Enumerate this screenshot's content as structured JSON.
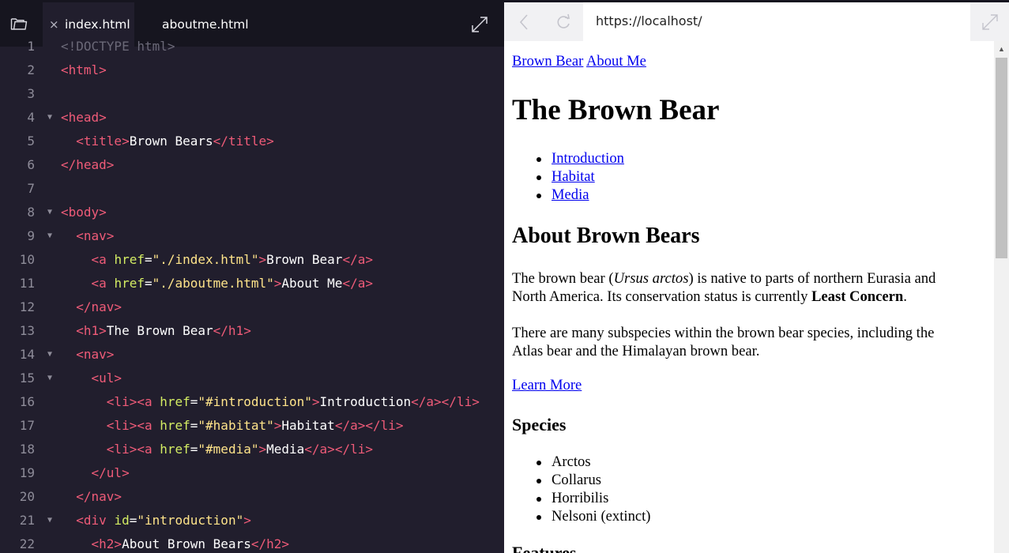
{
  "editor": {
    "tabs": [
      {
        "label": "index.html",
        "active": true,
        "close_glyph": "×"
      },
      {
        "label": "aboutme.html",
        "active": false
      }
    ],
    "lines": [
      {
        "n": "1",
        "fold": false,
        "html": "<span class='faded'>&lt;!DOCTYPE html&gt;</span>"
      },
      {
        "n": "2",
        "fold": false,
        "html": "<span class='t'>&lt;html&gt;</span>"
      },
      {
        "n": "3",
        "fold": false,
        "html": ""
      },
      {
        "n": "4",
        "fold": true,
        "html": "<span class='t'>&lt;head&gt;</span>"
      },
      {
        "n": "5",
        "fold": false,
        "html": "  <span class='t'>&lt;title&gt;</span>Brown Bears<span class='t'>&lt;/title&gt;</span>"
      },
      {
        "n": "6",
        "fold": false,
        "html": "<span class='t'>&lt;/head&gt;</span>"
      },
      {
        "n": "7",
        "fold": false,
        "html": ""
      },
      {
        "n": "8",
        "fold": true,
        "html": "<span class='t'>&lt;body&gt;</span>"
      },
      {
        "n": "9",
        "fold": true,
        "html": "  <span class='t'>&lt;nav&gt;</span>"
      },
      {
        "n": "10",
        "fold": false,
        "html": "    <span class='t'>&lt;a</span> <span class='an'>href</span><span class='eq'>=</span><span class='av'>\"./index.html\"</span><span class='t'>&gt;</span>Brown Bear<span class='t'>&lt;/a&gt;</span>"
      },
      {
        "n": "11",
        "fold": false,
        "html": "    <span class='t'>&lt;a</span> <span class='an'>href</span><span class='eq'>=</span><span class='av'>\"./aboutme.html\"</span><span class='t'>&gt;</span>About Me<span class='t'>&lt;/a&gt;</span>"
      },
      {
        "n": "12",
        "fold": false,
        "html": "  <span class='t'>&lt;/nav&gt;</span>"
      },
      {
        "n": "13",
        "fold": false,
        "html": "  <span class='t'>&lt;h1&gt;</span>The Brown Bear<span class='t'>&lt;/h1&gt;</span>"
      },
      {
        "n": "14",
        "fold": true,
        "html": "  <span class='t'>&lt;nav&gt;</span>"
      },
      {
        "n": "15",
        "fold": true,
        "html": "    <span class='t'>&lt;ul&gt;</span>"
      },
      {
        "n": "16",
        "fold": false,
        "html": "      <span class='t'>&lt;li&gt;&lt;a</span> <span class='an'>href</span><span class='eq'>=</span><span class='av'>\"#introduction\"</span><span class='t'>&gt;</span>Introduction<span class='t'>&lt;/a&gt;&lt;/li&gt;</span>"
      },
      {
        "n": "17",
        "fold": false,
        "html": "      <span class='t'>&lt;li&gt;&lt;a</span> <span class='an'>href</span><span class='eq'>=</span><span class='av'>\"#habitat\"</span><span class='t'>&gt;</span>Habitat<span class='t'>&lt;/a&gt;&lt;/li&gt;</span>"
      },
      {
        "n": "18",
        "fold": false,
        "html": "      <span class='t'>&lt;li&gt;&lt;a</span> <span class='an'>href</span><span class='eq'>=</span><span class='av'>\"#media\"</span><span class='t'>&gt;</span>Media<span class='t'>&lt;/a&gt;&lt;/li&gt;</span>"
      },
      {
        "n": "19",
        "fold": false,
        "html": "    <span class='t'>&lt;/ul&gt;</span>"
      },
      {
        "n": "20",
        "fold": false,
        "html": "  <span class='t'>&lt;/nav&gt;</span>"
      },
      {
        "n": "21",
        "fold": true,
        "html": "  <span class='t'>&lt;div</span> <span class='an'>id</span><span class='eq'>=</span><span class='av'>\"introduction\"</span><span class='t'>&gt;</span>"
      },
      {
        "n": "22",
        "fold": false,
        "html": "    <span class='t'>&lt;h2&gt;</span>About Brown Bears<span class='t'>&lt;/h2&gt;</span>"
      }
    ]
  },
  "browser": {
    "url": "https://localhost/",
    "page": {
      "nav_links": [
        "Brown Bear",
        "About Me"
      ],
      "h1": "The Brown Bear",
      "toc": [
        "Introduction",
        "Habitat",
        "Media"
      ],
      "h2": "About Brown Bears",
      "p1_a": "The brown bear (",
      "p1_italic": "Ursus arctos",
      "p1_b": ") is native to parts of northern Eurasia and",
      "p1_c": "North America. Its conservation status is currently ",
      "p1_bold": "Least Concern",
      "p1_d": ".",
      "p2_line1": "There are many subspecies within the brown bear species, including the",
      "p2_line2": "Atlas bear and the Himalayan brown bear.",
      "learn_more": "Learn More",
      "h3_species": "Species",
      "species": [
        "Arctos",
        "Collarus",
        "Horribilis",
        "Nelsoni (extinct)"
      ],
      "h3_features": "Features"
    }
  },
  "icons": {
    "folder": "folder-icon",
    "close": "close-icon",
    "expand": "expand-icon",
    "back": "back-arrow-icon",
    "reload": "reload-icon",
    "popout": "popout-icon"
  }
}
